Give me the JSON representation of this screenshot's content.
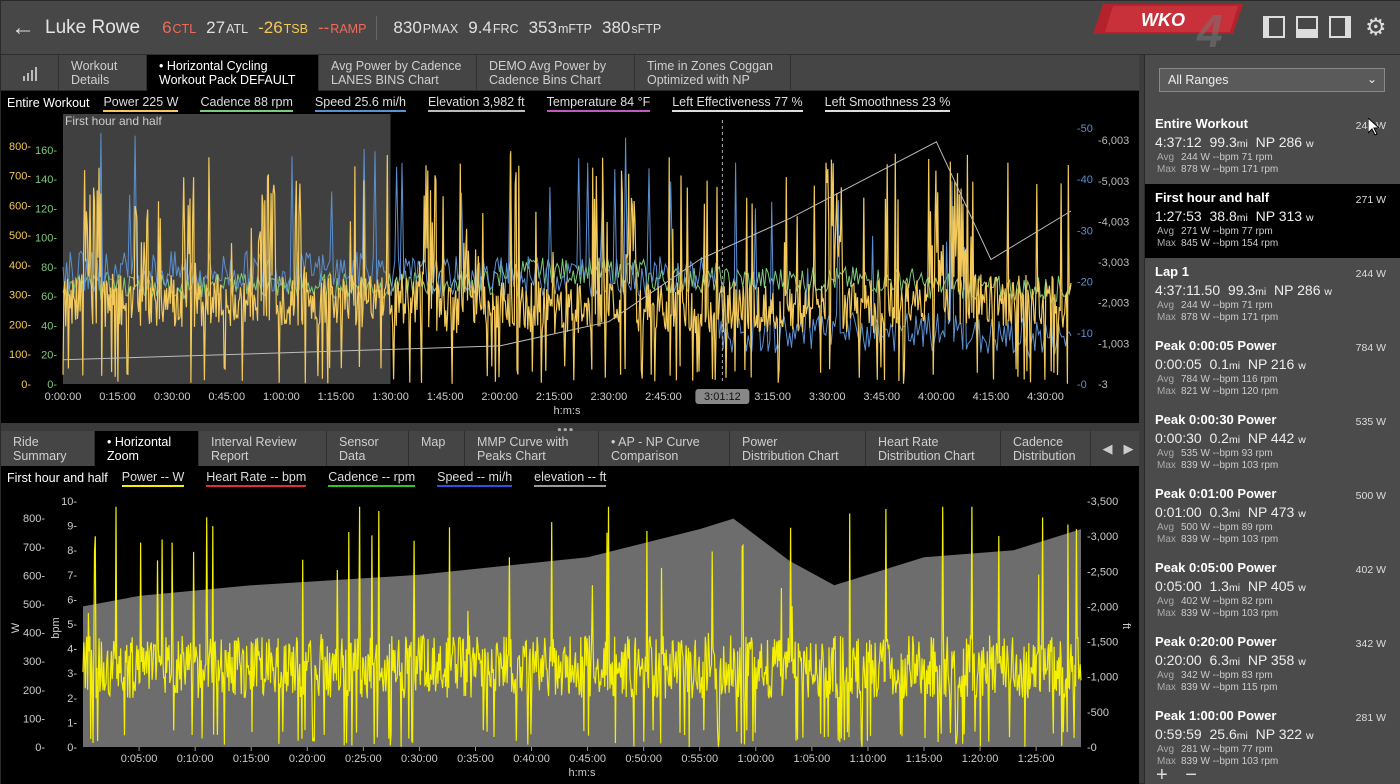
{
  "header": {
    "athlete": "Luke Rowe",
    "metrics": [
      {
        "value": "6",
        "unit": "CTL",
        "color": "#f26a5a"
      },
      {
        "value": "27",
        "unit": "ATL",
        "color": "#e0e0e0"
      },
      {
        "value": "-26",
        "unit": "TSB",
        "color": "#f2c95a"
      },
      {
        "value": "--",
        "unit": "RAMP",
        "color": "#f26a5a"
      },
      {
        "value": "830",
        "unit": "PMAX",
        "color": "#e0e0e0"
      },
      {
        "value": "9.4",
        "unit": "FRC",
        "color": "#e0e0e0"
      },
      {
        "value": "353",
        "unit": "mFTP",
        "color": "#e0e0e0"
      },
      {
        "value": "380",
        "unit": "sFTP",
        "color": "#e0e0e0"
      }
    ],
    "logo_text": "WKO",
    "logo_number": "4"
  },
  "top_tabs": [
    {
      "line1": "Workout",
      "line2": "Details",
      "active": false
    },
    {
      "line1": "• Horizontal Cycling",
      "line2": "Workout Pack DEFAULT",
      "active": true
    },
    {
      "line1": "Avg Power by Cadence",
      "line2": "LANES BINS Chart",
      "active": false
    },
    {
      "line1": "DEMO Avg Power by",
      "line2": "Cadence Bins Chart",
      "active": false
    },
    {
      "line1": "Time in Zones Coggan",
      "line2": "Optimized with NP",
      "active": false
    }
  ],
  "chart1": {
    "legend_title": "Entire Workout",
    "legend": [
      {
        "label": "Power  225 W",
        "color": "#f2c95a"
      },
      {
        "label": "Cadence  88 rpm",
        "color": "#7dc97d"
      },
      {
        "label": "Speed  25.6 mi/h",
        "color": "#5a8fd0"
      },
      {
        "label": "Elevation  3,982 ft",
        "color": "#bbbbbb"
      },
      {
        "label": "Temperature  84 °F",
        "color": "#c05ac0"
      },
      {
        "label": "Left Effectiveness  77 %",
        "color": "#dddddd"
      },
      {
        "label": "Left Smoothness  23 %",
        "color": "#dddddd"
      }
    ],
    "range_label": "First hour and half",
    "cursor_label": "3:01:12",
    "xlabel": "h:m:s"
  },
  "chart_data": [
    {
      "type": "line",
      "title": "Entire Workout",
      "xlabel": "h:m:s",
      "x_ticks": [
        "0:00:00",
        "0:15:00",
        "0:30:00",
        "0:45:00",
        "1:00:00",
        "1:15:00",
        "1:30:00",
        "1:45:00",
        "2:00:00",
        "2:15:00",
        "2:30:00",
        "2:45:00",
        "3:00:00",
        "3:15:00",
        "3:30:00",
        "3:45:00",
        "4:00:00",
        "4:15:00",
        "4:30:00"
      ],
      "xlim_min": [
        0,
        277
      ],
      "y_left_power_ticks": [
        "0-",
        "100-",
        "200-",
        "300-",
        "400-",
        "500-",
        "600-",
        "700-",
        "800-"
      ],
      "y_left_power_range": [
        0,
        860
      ],
      "y_left_cadence_ticks": [
        "0",
        "20",
        "40",
        "60",
        "80",
        "100",
        "120",
        "140",
        "160"
      ],
      "y_right_speed_ticks": [
        "0",
        "10",
        "20",
        "30",
        "40",
        "50"
      ],
      "y_right_speed_range": [
        0,
        50
      ],
      "y_right_elev_ticks": [
        "-3",
        "-1,003",
        "-2,003",
        "-3,003",
        "-4,003",
        "-5,003",
        "-6,003"
      ],
      "highlight_range_min": [
        0,
        90
      ],
      "cursor_min": 181.2,
      "series": [
        {
          "name": "Power",
          "color": "#f2c95a",
          "avg": 225,
          "unit": "W",
          "peaks_min": [
            [
              8,
              780
            ],
            [
              22,
              640
            ],
            [
              35,
              700
            ],
            [
              56,
              720
            ],
            [
              65,
              690
            ],
            [
              100,
              740
            ],
            [
              112,
              560
            ],
            [
              148,
              760
            ],
            [
              156,
              720
            ],
            [
              212,
              820
            ],
            [
              240,
              830
            ],
            [
              246,
              780
            ]
          ]
        },
        {
          "name": "Cadence",
          "color": "#7dc97d",
          "avg": 88,
          "unit": "rpm"
        },
        {
          "name": "Speed",
          "color": "#5a8fd0",
          "avg": 25.6,
          "unit": "mi/h"
        },
        {
          "name": "Elevation",
          "color": "#bbbbbb",
          "avg": 3982,
          "unit": "ft",
          "points_min_ft": [
            [
              0,
              2850
            ],
            [
              60,
              2950
            ],
            [
              120,
              3050
            ],
            [
              150,
              3400
            ],
            [
              175,
              4300
            ],
            [
              200,
              4900
            ],
            [
              240,
              6000
            ],
            [
              255,
              4300
            ],
            [
              277,
              5000
            ]
          ]
        }
      ]
    },
    {
      "type": "line",
      "title": "First hour and half",
      "xlabel": "h:m:s",
      "x_ticks": [
        "0:05:00",
        "0:10:00",
        "0:15:00",
        "0:20:00",
        "0:25:00",
        "0:30:00",
        "0:35:00",
        "0:40:00",
        "0:45:00",
        "0:50:00",
        "0:55:00",
        "1:00:00",
        "1:05:00",
        "1:10:00",
        "1:15:00",
        "1:20:00",
        "1:25:00"
      ],
      "y_left_power_ticks": [
        "0-",
        "100-",
        "200-",
        "300-",
        "400-",
        "500-",
        "600-",
        "700-",
        "800-"
      ],
      "y_left_power_range": [
        0,
        860
      ],
      "y_left_hr_ticks": [
        "0",
        "1",
        "2",
        "3",
        "4",
        "5",
        "6",
        "7",
        "8",
        "9",
        "10"
      ],
      "y_right_elev_ticks": [
        "0",
        "500",
        "1,000",
        "1,500",
        "2,000",
        "2,500",
        "3,000",
        "3,500"
      ],
      "y_right_elev_range": [
        0,
        3500
      ],
      "ylabel_left": "W",
      "ylabel_left2": "bpm",
      "ylabel_right": "ft",
      "series": [
        {
          "name": "Power",
          "color": "#f5f000",
          "unit": "W"
        },
        {
          "name": "elevation",
          "color": "#6d6d6d",
          "unit": "ft",
          "points_min_ft": [
            [
              0,
              2000
            ],
            [
              5,
              2150
            ],
            [
              15,
              2300
            ],
            [
              30,
              2450
            ],
            [
              45,
              2700
            ],
            [
              55,
              3100
            ],
            [
              58,
              3250
            ],
            [
              63,
              2650
            ],
            [
              67,
              2300
            ],
            [
              75,
              2700
            ],
            [
              83,
              2800
            ],
            [
              89,
              3100
            ]
          ]
        }
      ]
    }
  ],
  "chart2": {
    "legend_title": "First hour and half",
    "legend": [
      {
        "label": "Power  -- W",
        "color": "#f5f000"
      },
      {
        "label": "Heart Rate  -- bpm",
        "color": "#e03030"
      },
      {
        "label": "Cadence  -- rpm",
        "color": "#30c030"
      },
      {
        "label": "Speed  -- mi/h",
        "color": "#3050e0"
      },
      {
        "label": "elevation  -- ft",
        "color": "#999999"
      }
    ],
    "xlabel": "h:m:s"
  },
  "bottom_tabs": [
    {
      "line1": "Ride",
      "line2": "Summary",
      "active": false
    },
    {
      "line1": "• Horizontal",
      "line2": "Zoom",
      "active": true
    },
    {
      "line1": "Interval Review",
      "line2": "Report",
      "active": false
    },
    {
      "line1": "Sensor",
      "line2": "Data",
      "active": false
    },
    {
      "line1": "Map",
      "line2": "",
      "active": false
    },
    {
      "line1": "MMP Curve with",
      "line2": "Peaks Chart",
      "active": false
    },
    {
      "line1": "• AP - NP Curve",
      "line2": "Comparison",
      "active": false
    },
    {
      "line1": "Power",
      "line2": "Distribution Chart",
      "active": false
    },
    {
      "line1": "Heart Rate",
      "line2": "Distribution Chart",
      "active": false
    },
    {
      "line1": "Cadence",
      "line2": "Distribution",
      "active": false
    }
  ],
  "ranges_panel": {
    "selector": "All Ranges",
    "ranges": [
      {
        "name": "Entire Workout",
        "w": "244 W",
        "duration": "4:37:12",
        "dist": "99.3",
        "np": "NP 286",
        "avg": "244 W  --bpm  71 rpm",
        "max": "878 W  --bpm  171 rpm",
        "selected": false
      },
      {
        "name": "First hour and half",
        "w": "271 W",
        "duration": "1:27:53",
        "dist": "38.8",
        "np": "NP 313",
        "avg": "271 W  --bpm  77 rpm",
        "max": "845 W  --bpm  154 rpm",
        "selected": true
      },
      {
        "name": "Lap 1",
        "w": "244 W",
        "duration": "4:37:11.50",
        "dist": "99.3",
        "np": "NP 286",
        "avg": "244 W  --bpm  71 rpm",
        "max": "878 W  --bpm  171 rpm",
        "selected": false
      },
      {
        "name": "Peak 0:00:05 Power",
        "w": "784 W",
        "duration": "0:00:05",
        "dist": "0.1",
        "np": "NP 216",
        "avg": "784 W  --bpm  116 rpm",
        "max": "821 W  --bpm  120 rpm",
        "selected": false
      },
      {
        "name": "Peak 0:00:30 Power",
        "w": "535 W",
        "duration": "0:00:30",
        "dist": "0.2",
        "np": "NP 442",
        "avg": "535 W  --bpm  93 rpm",
        "max": "839 W  --bpm  103 rpm",
        "selected": false
      },
      {
        "name": "Peak 0:01:00 Power",
        "w": "500 W",
        "duration": "0:01:00",
        "dist": "0.3",
        "np": "NP 473",
        "avg": "500 W  --bpm  89 rpm",
        "max": "839 W  --bpm  103 rpm",
        "selected": false
      },
      {
        "name": "Peak 0:05:00 Power",
        "w": "402 W",
        "duration": "0:05:00",
        "dist": "1.3",
        "np": "NP 405",
        "avg": "402 W  --bpm  82 rpm",
        "max": "839 W  --bpm  103 rpm",
        "selected": false
      },
      {
        "name": "Peak 0:20:00 Power",
        "w": "342 W",
        "duration": "0:20:00",
        "dist": "6.3",
        "np": "NP 358",
        "avg": "342 W  --bpm  83 rpm",
        "max": "839 W  --bpm  115 rpm",
        "selected": false
      },
      {
        "name": "Peak 1:00:00 Power",
        "w": "281 W",
        "duration": "0:59:59",
        "dist": "25.6",
        "np": "NP 322",
        "avg": "281 W  --bpm  77 rpm",
        "max": "839 W  --bpm  103 rpm",
        "selected": false
      }
    ],
    "labels": {
      "mi": "mi",
      "w": "w",
      "avg": "Avg",
      "max": "Max"
    },
    "add_remove": "+ −"
  }
}
